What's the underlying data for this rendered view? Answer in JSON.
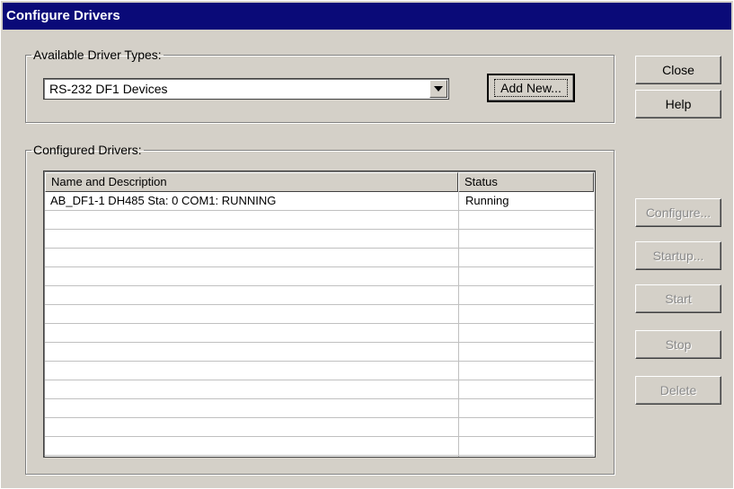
{
  "window": {
    "title": "Configure Drivers"
  },
  "available": {
    "legend": "Available Driver Types:",
    "selected": "RS-232 DF1 Devices",
    "add_new": "Add New..."
  },
  "configured": {
    "legend": "Configured Drivers:",
    "columns": [
      "Name and Description",
      "Status"
    ],
    "rows": [
      {
        "name": "AB_DF1-1 DH485 Sta: 0 COM1: RUNNING",
        "status": "Running"
      }
    ]
  },
  "buttons": {
    "close": "Close",
    "help": "Help",
    "configure": "Configure...",
    "startup": "Startup...",
    "start": "Start",
    "stop": "Stop",
    "delete": "Delete"
  }
}
